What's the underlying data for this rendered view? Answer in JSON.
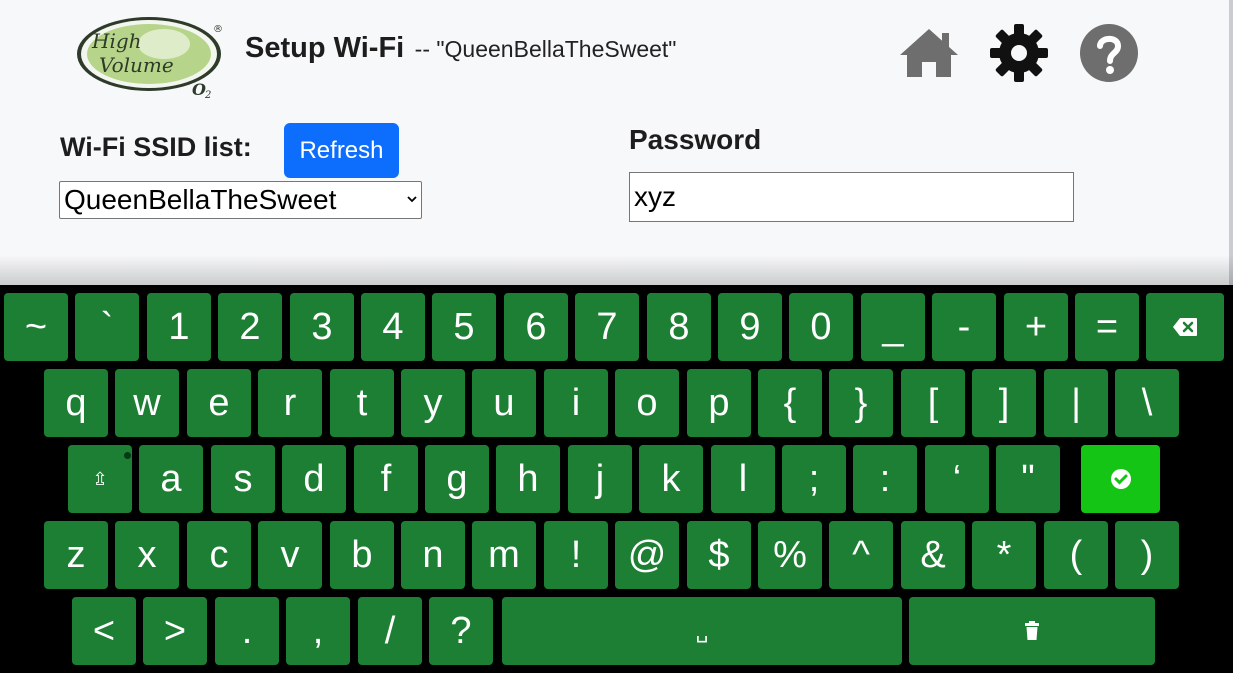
{
  "header": {
    "logo": {
      "line1": "High",
      "line2": "Volume",
      "o2": "O2",
      "registered": "®",
      "colors": {
        "fill": "#b7d58a",
        "outline": "#2e3b2a"
      }
    },
    "title": "Setup Wi-Fi",
    "subtitle": "-- \"QueenBellaTheSweet\"",
    "icons": {
      "home": "home-icon",
      "settings": "gear-icon",
      "help": "help-icon"
    }
  },
  "wifi": {
    "ssid_label": "Wi-Fi SSID list:",
    "refresh_label": "Refresh",
    "selected_ssid": "QueenBellaTheSweet",
    "password_label": "Password",
    "password_value": "xyz"
  },
  "colors": {
    "accent": "#0d6efd",
    "key": "#1c7f33",
    "enter_key": "#15c516",
    "keyboard_bg": "#000000"
  },
  "keyboard": {
    "rows": [
      [
        "~",
        "`",
        "1",
        "2",
        "3",
        "4",
        "5",
        "6",
        "7",
        "8",
        "9",
        "0",
        "_",
        "-",
        "+",
        "=",
        "backspace"
      ],
      [
        "q",
        "w",
        "e",
        "r",
        "t",
        "y",
        "u",
        "i",
        "o",
        "p",
        "{",
        "}",
        "[",
        "]",
        "|",
        "\\"
      ],
      [
        "shift",
        "a",
        "s",
        "d",
        "f",
        "g",
        "h",
        "j",
        "k",
        "l",
        ";",
        ":",
        "‘",
        "\"",
        "enter"
      ],
      [
        "z",
        "x",
        "c",
        "v",
        "b",
        "n",
        "m",
        "!",
        "@",
        "$",
        "%",
        "^",
        "&",
        "*",
        "(",
        ")"
      ],
      [
        "<",
        ">",
        ".",
        ",",
        "/",
        "?",
        "space",
        "clear"
      ]
    ],
    "labels": {
      "shift": "⇫",
      "space": "␣"
    }
  }
}
